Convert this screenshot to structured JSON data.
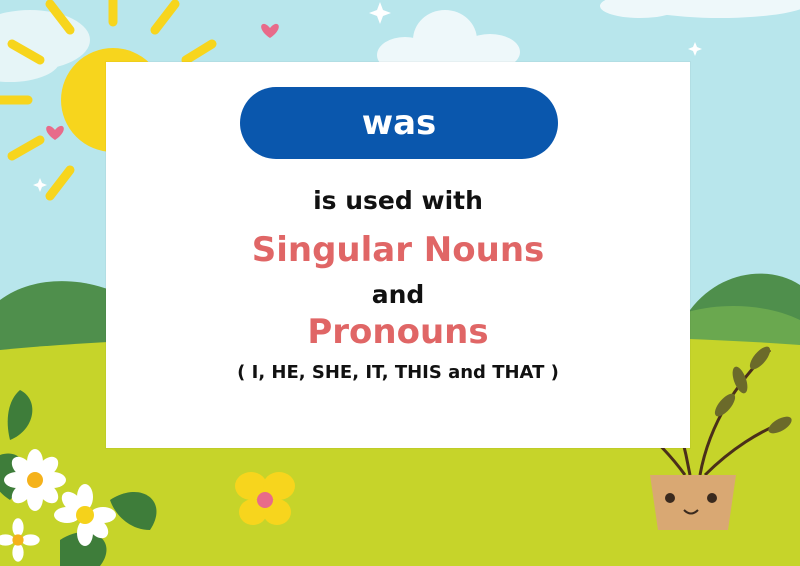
{
  "colors": {
    "sky": "#b8e6ec",
    "grass": "#c6d42a",
    "hill_dark": "#4f8f4c",
    "sun": "#f7d51d",
    "pill": "#0a57ad",
    "accent": "#e06666",
    "white": "#ffffff"
  },
  "card": {
    "badge": "was",
    "line1": "is used with",
    "line2": "Singular Nouns",
    "line3": "and",
    "line4": "Pronouns",
    "line5": "( I, HE, SHE, IT, THIS and THAT )"
  }
}
